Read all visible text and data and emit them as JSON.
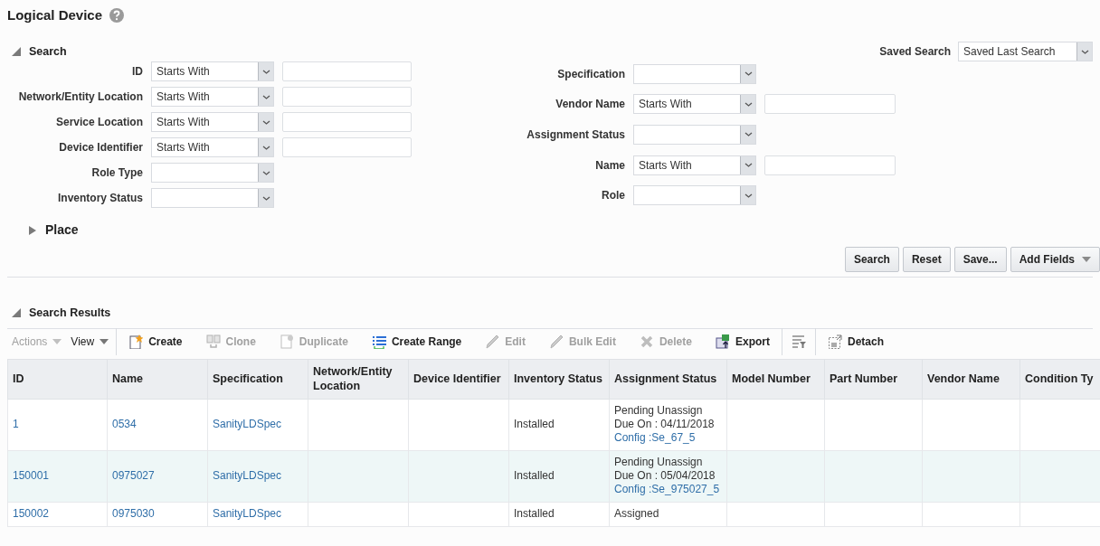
{
  "page": {
    "title": "Logical Device"
  },
  "search": {
    "title": "Search",
    "expanded": true,
    "saved_search": {
      "label": "Saved Search",
      "value": "Saved Last Search"
    },
    "left_fields": [
      {
        "label": "ID",
        "kind": "operator",
        "operator": "Starts With"
      },
      {
        "label": "Network/Entity Location",
        "kind": "operator",
        "operator": "Starts With"
      },
      {
        "label": "Service Location",
        "kind": "operator",
        "operator": "Starts With"
      },
      {
        "label": "Device Identifier",
        "kind": "operator",
        "operator": "Starts With"
      },
      {
        "label": "Role Type",
        "kind": "select"
      },
      {
        "label": "Inventory Status",
        "kind": "select"
      }
    ],
    "right_fields": [
      {
        "label": "Specification",
        "kind": "select"
      },
      {
        "label": "Vendor Name",
        "kind": "operator",
        "operator": "Starts With"
      },
      {
        "label": "Assignment Status",
        "kind": "select"
      },
      {
        "label": "Name",
        "kind": "operator",
        "operator": "Starts With"
      },
      {
        "label": "Role",
        "kind": "select"
      }
    ],
    "place": {
      "label": "Place",
      "expanded": false
    },
    "buttons": [
      {
        "label": "Search",
        "kind": "button"
      },
      {
        "label": "Reset",
        "kind": "button"
      },
      {
        "label": "Save...",
        "kind": "button"
      },
      {
        "label": "Add Fields",
        "kind": "menu"
      }
    ]
  },
  "results": {
    "title": "Search Results",
    "expanded": true,
    "toolbar": [
      {
        "label": "Actions",
        "kind": "menu",
        "disabled": true
      },
      {
        "label": "View",
        "kind": "menu",
        "disabled": false
      },
      {
        "kind": "separator"
      },
      {
        "label": "Create",
        "kind": "action",
        "disabled": false
      },
      {
        "label": "Clone",
        "kind": "action",
        "disabled": true
      },
      {
        "label": "Duplicate",
        "kind": "action",
        "disabled": true
      },
      {
        "label": "Create Range",
        "kind": "action",
        "disabled": false
      },
      {
        "label": "Edit",
        "kind": "action",
        "disabled": true
      },
      {
        "label": "Bulk Edit",
        "kind": "action",
        "disabled": true
      },
      {
        "label": "Delete",
        "kind": "action",
        "disabled": true
      },
      {
        "label": "Export",
        "kind": "action",
        "disabled": false
      },
      {
        "kind": "separator"
      },
      {
        "kind": "icon",
        "disabled": false
      },
      {
        "kind": "separator"
      },
      {
        "label": "Detach",
        "kind": "action",
        "disabled": false
      }
    ],
    "columns": [
      "ID",
      "Name",
      "Specification",
      "Network/Entity Location",
      "Device Identifier",
      "Inventory Status",
      "Assignment Status",
      "Model Number",
      "Part Number",
      "Vendor Name",
      "Condition Ty"
    ],
    "rows": [
      {
        "selected": false,
        "id": "1",
        "name": "0534",
        "specification": "SanityLDSpec",
        "inventory_status": "Installed",
        "assignment_status": [
          {
            "text": "Pending Unassign",
            "kind": "text"
          },
          {
            "text": "Due On : 04/11/2018",
            "kind": "text"
          },
          {
            "text": "Config :Se_67_5",
            "kind": "link"
          }
        ]
      },
      {
        "selected": true,
        "id": "150001",
        "name": "0975027",
        "specification": "SanityLDSpec",
        "inventory_status": "Installed",
        "assignment_status": [
          {
            "text": "Pending Unassign",
            "kind": "text"
          },
          {
            "text": "Due On : 05/04/2018",
            "kind": "text"
          },
          {
            "text": "Config :Se_975027_5",
            "kind": "link"
          }
        ]
      },
      {
        "selected": false,
        "id": "150002",
        "name": "0975030",
        "specification": "SanityLDSpec",
        "inventory_status": "Installed",
        "assignment_status": [
          {
            "text": "Assigned",
            "kind": "text"
          }
        ]
      }
    ]
  }
}
